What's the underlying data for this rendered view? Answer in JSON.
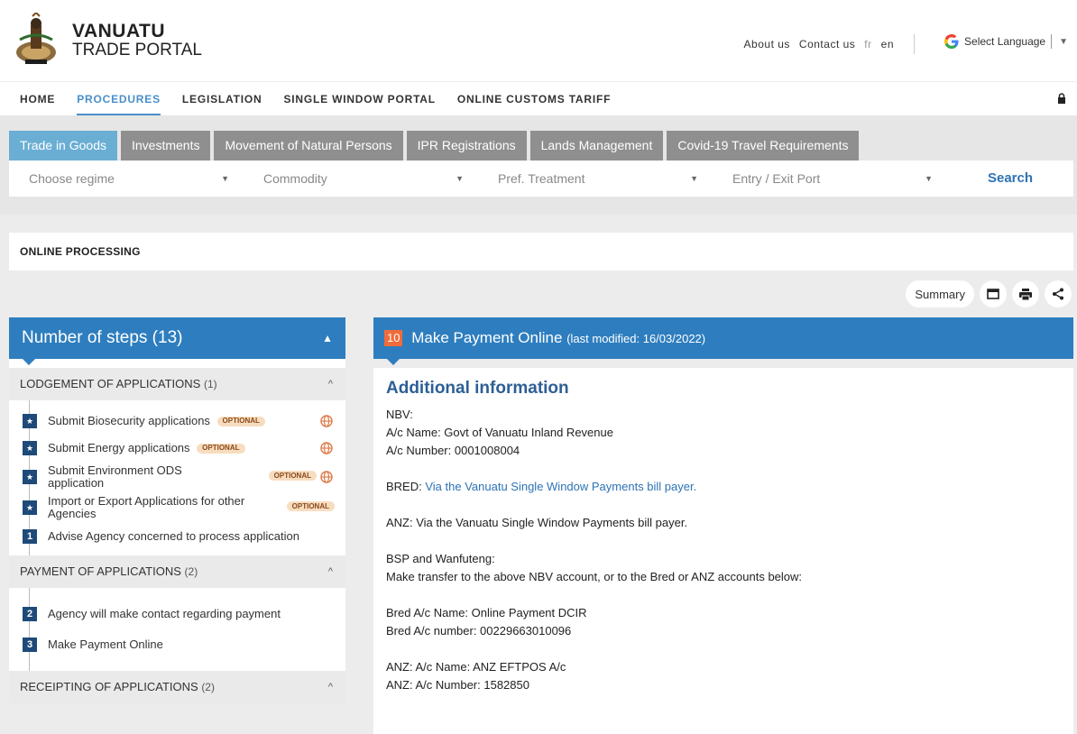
{
  "header": {
    "logo_title": "VANUATU",
    "logo_sub": "TRADE PORTAL",
    "links": {
      "about": "About us",
      "contact": "Contact us",
      "fr": "fr",
      "en": "en"
    },
    "language": "Select Language"
  },
  "nav": [
    "HOME",
    "PROCEDURES",
    "LEGISLATION",
    "SINGLE WINDOW PORTAL",
    "ONLINE CUSTOMS TARIFF"
  ],
  "tabs": [
    "Trade in Goods",
    "Investments",
    "Movement of Natural Persons",
    "IPR Registrations",
    "Lands Management",
    "Covid-19 Travel Requirements"
  ],
  "filters": {
    "regime": "Choose regime",
    "commodity": "Commodity",
    "pref": "Pref. Treatment",
    "port": "Entry / Exit Port",
    "search": "Search"
  },
  "section_title": "ONLINE PROCESSING",
  "tools": {
    "summary": "Summary"
  },
  "steps_panel": {
    "title": "Number of steps (13)",
    "groups": [
      {
        "label": "LODGEMENT OF APPLICATIONS",
        "count": "(1)",
        "items": [
          "Submit Biosecurity applications",
          "Submit Energy applications",
          "Submit Environment ODS application",
          "Import or Export Applications for other Agencies",
          "Advise Agency concerned to process application"
        ],
        "optional": "OPTIONAL"
      },
      {
        "label": "PAYMENT OF APPLICATIONS",
        "count": "(2)",
        "items": [
          "Agency will make contact regarding payment",
          "Make Payment Online"
        ]
      },
      {
        "label": "RECEIPTING OF APPLICATIONS",
        "count": "(2)"
      }
    ],
    "badges": [
      "1",
      "2",
      "3"
    ]
  },
  "detail": {
    "step_num": "10",
    "title": "Make Payment Online",
    "modified": "(last modified: 16/03/2022)",
    "heading": "Additional information",
    "lines": {
      "nbv": "NBV:",
      "nbv_name": "A/c Name: Govt of Vanuatu Inland Revenue",
      "nbv_number": "A/c Number: 0001008004",
      "bred_label": "BRED:",
      "bred_link": "Via the Vanuatu Single Window Payments bill payer.",
      "anz": "ANZ: Via the Vanuatu Single Window Payments bill payer.",
      "bsp": "BSP and Wanfuteng:",
      "bsp_text": "Make transfer to the above NBV account, or to the Bred or ANZ accounts below:",
      "bred_name": "Bred A/c Name: Online Payment DCIR",
      "bred_number": "Bred A/c number: 00229663010096",
      "anz_name": "ANZ: A/c Name: ANZ EFTPOS A/c",
      "anz_number": "ANZ: A/c Number: 1582850"
    }
  }
}
